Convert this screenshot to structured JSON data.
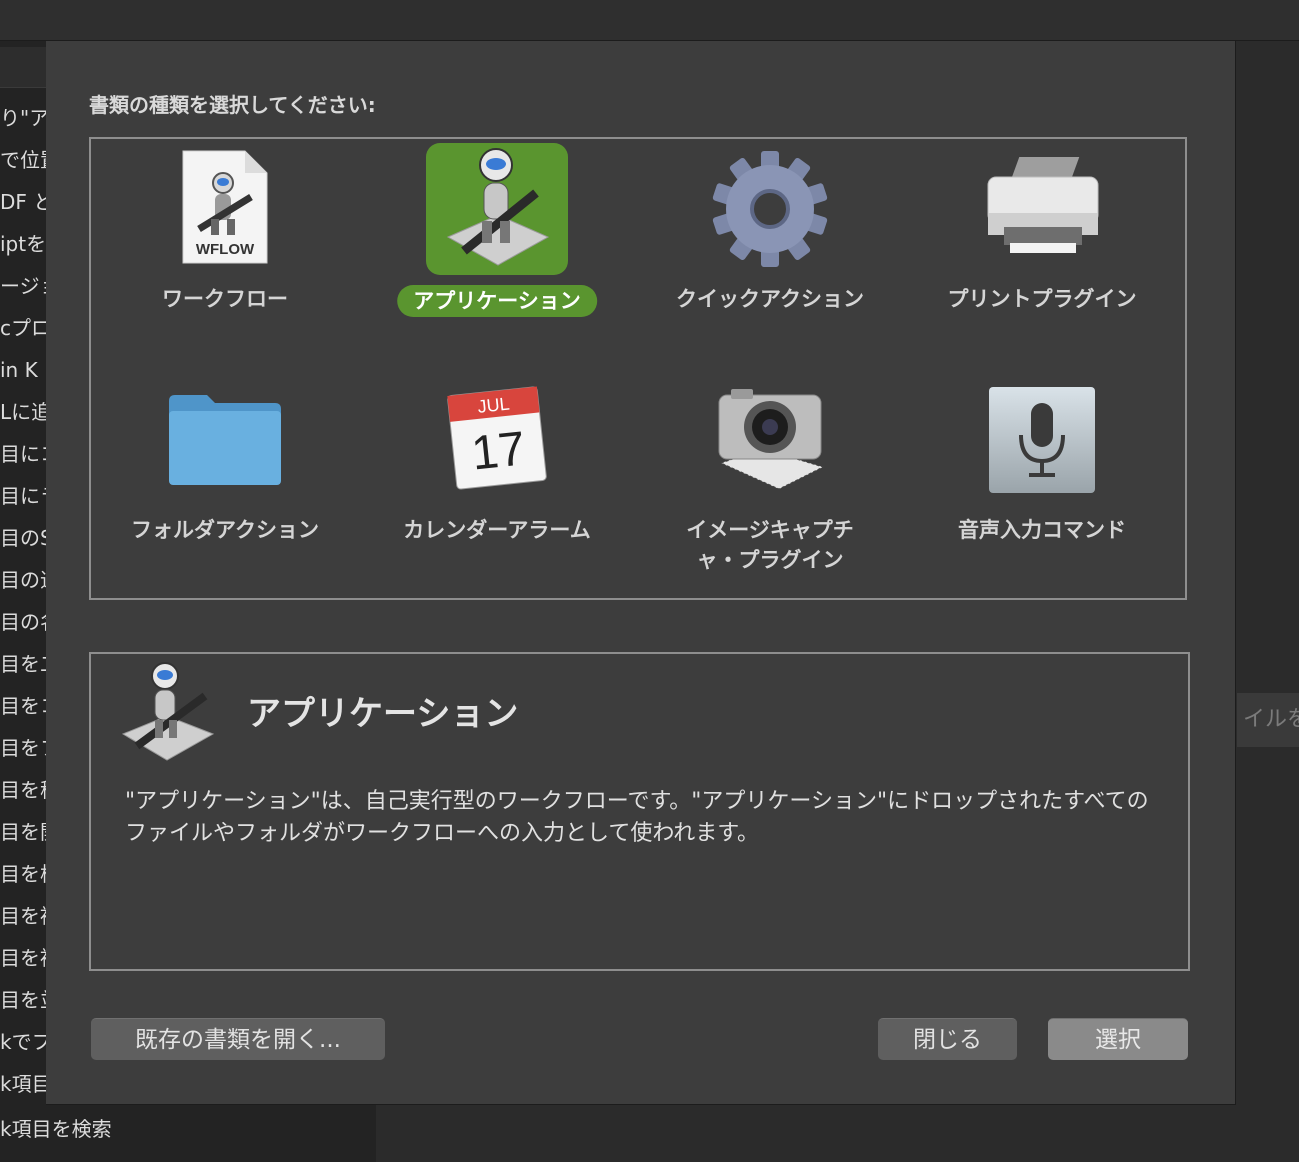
{
  "background_list": {
    "items": [
      "り\"ア",
      "で位置",
      "DF と",
      "iptを",
      "ージョ",
      "cプロ",
      " in K",
      "Lに追",
      "目にコ",
      "目にラ",
      "目のS",
      "目の追",
      "目の名",
      "目を二",
      "目をコ",
      "目をフ",
      "目を移",
      "目を開",
      "目を検",
      "目を複",
      "目を複",
      "目を並",
      "kでフ",
      "k項目"
    ],
    "bottom_item": "k項目を検索"
  },
  "right_edge_button": "イルを",
  "dialog": {
    "prompt": "書類の種類を選択してください:",
    "types": [
      {
        "label": "ワークフロー",
        "icon": "workflow-document-icon",
        "selected": false
      },
      {
        "label": "アプリケーション",
        "icon": "automator-robot-icon",
        "selected": true
      },
      {
        "label": "クイックアクション",
        "icon": "gear-icon",
        "selected": false
      },
      {
        "label": "プリントプラグイン",
        "icon": "printer-icon",
        "selected": false
      },
      {
        "label": "フォルダアクション",
        "icon": "folder-icon",
        "selected": false
      },
      {
        "label": "カレンダーアラーム",
        "icon": "calendar-icon",
        "selected": false
      },
      {
        "label": "イメージキャプチャ・プラグイン",
        "label_lines": [
          "イメージキャプチ",
          "ャ・プラグイン"
        ],
        "icon": "camera-icon",
        "selected": false
      },
      {
        "label": "音声入力コマンド",
        "icon": "microphone-icon",
        "selected": false
      }
    ],
    "workflow_file_label": "WFLOW",
    "calendar_month": "JUL",
    "calendar_day": "17",
    "description": {
      "title": "アプリケーション",
      "text": "\"アプリケーション\"は、自己実行型のワークフローです。\"アプリケーション\"にドロップされたすべてのファイルやフォルダがワークフローへの入力として使われます。"
    },
    "buttons": {
      "open_existing": "既存の書類を開く...",
      "close": "閉じる",
      "select": "選択"
    },
    "accent_color": "#5a952f"
  }
}
